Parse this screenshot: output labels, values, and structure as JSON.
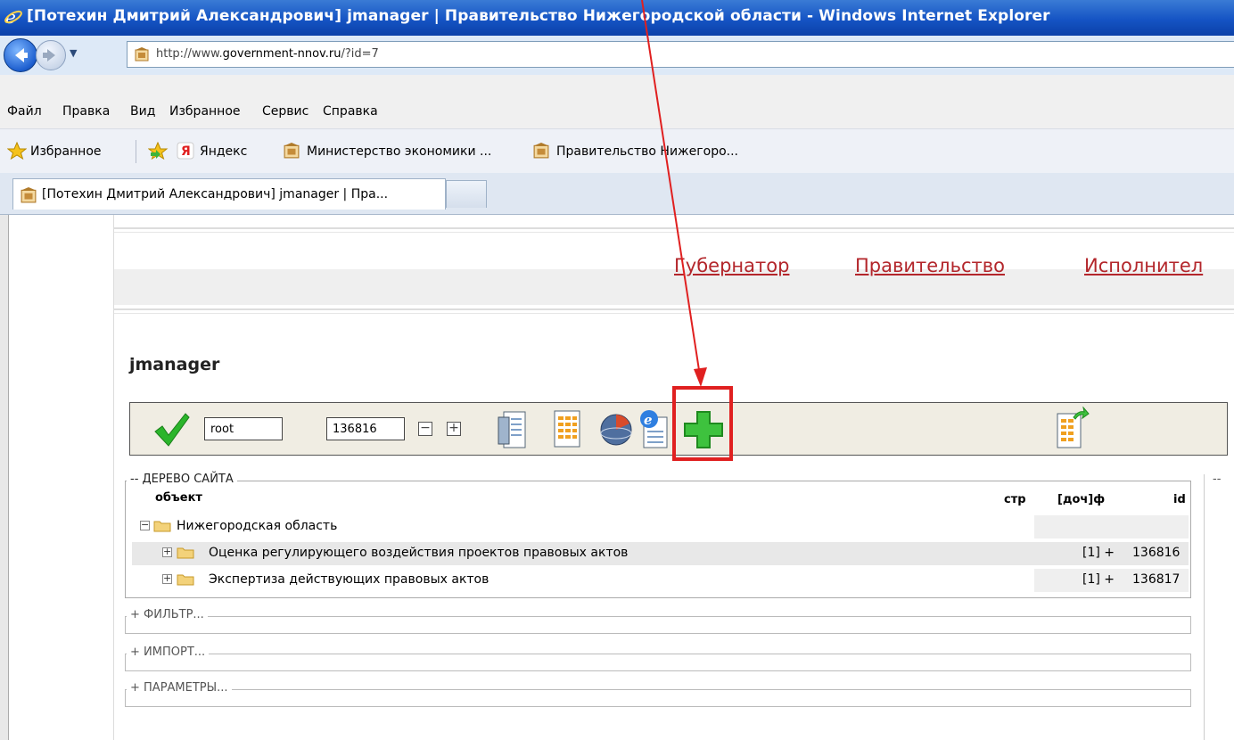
{
  "window": {
    "title": "[Потехин Дмитрий Александрович] jmanager | Правительство Нижегородской области - Windows Internet Explorer"
  },
  "address": {
    "url_prefix": "http://www.",
    "url_domain": "government-nnov.ru",
    "url_suffix": "/?id=7"
  },
  "menu": [
    "Файл",
    "Правка",
    "Вид",
    "Избранное",
    "Сервис",
    "Справка"
  ],
  "favorites": {
    "label": "Избранное",
    "items": [
      "Яндекс",
      "Министерство экономики ...",
      "Правительство Нижегоро..."
    ]
  },
  "tabs": {
    "active": "[Потехин Дмитрий Александрович] jmanager | Пра..."
  },
  "site_nav": [
    "Губернатор",
    "Правительство",
    "Исполнител"
  ],
  "app": {
    "title": "jmanager",
    "toolbar": {
      "root_value": "root",
      "id_value": "136816",
      "minus": "−",
      "plus": "+"
    }
  },
  "tree": {
    "legend": "-- ДЕРЕВО САЙТА",
    "columns": {
      "object": "объект",
      "str": "стр",
      "doc": "[доч]ф",
      "id": "id"
    },
    "rows": [
      {
        "name": "Нижегородская область",
        "toggle": "−",
        "doc": "",
        "id": ""
      },
      {
        "name": "Оценка регулирующего воздействия проектов правовых актов",
        "toggle": "+",
        "doc": "[1] +",
        "id": "136816"
      },
      {
        "name": "Экспертиза действующих правовых актов",
        "toggle": "+",
        "doc": "[1] +",
        "id": "136817"
      }
    ]
  },
  "sections": {
    "filter": "+ ФИЛЬТР...",
    "import": "+ ИМПОРТ...",
    "params": "+ ПАРАМЕТРЫ..."
  },
  "right_legend": "--",
  "colors": {
    "annotation": "#e02020",
    "nav_link": "#b3262b",
    "titlebar": "#1554c4"
  }
}
